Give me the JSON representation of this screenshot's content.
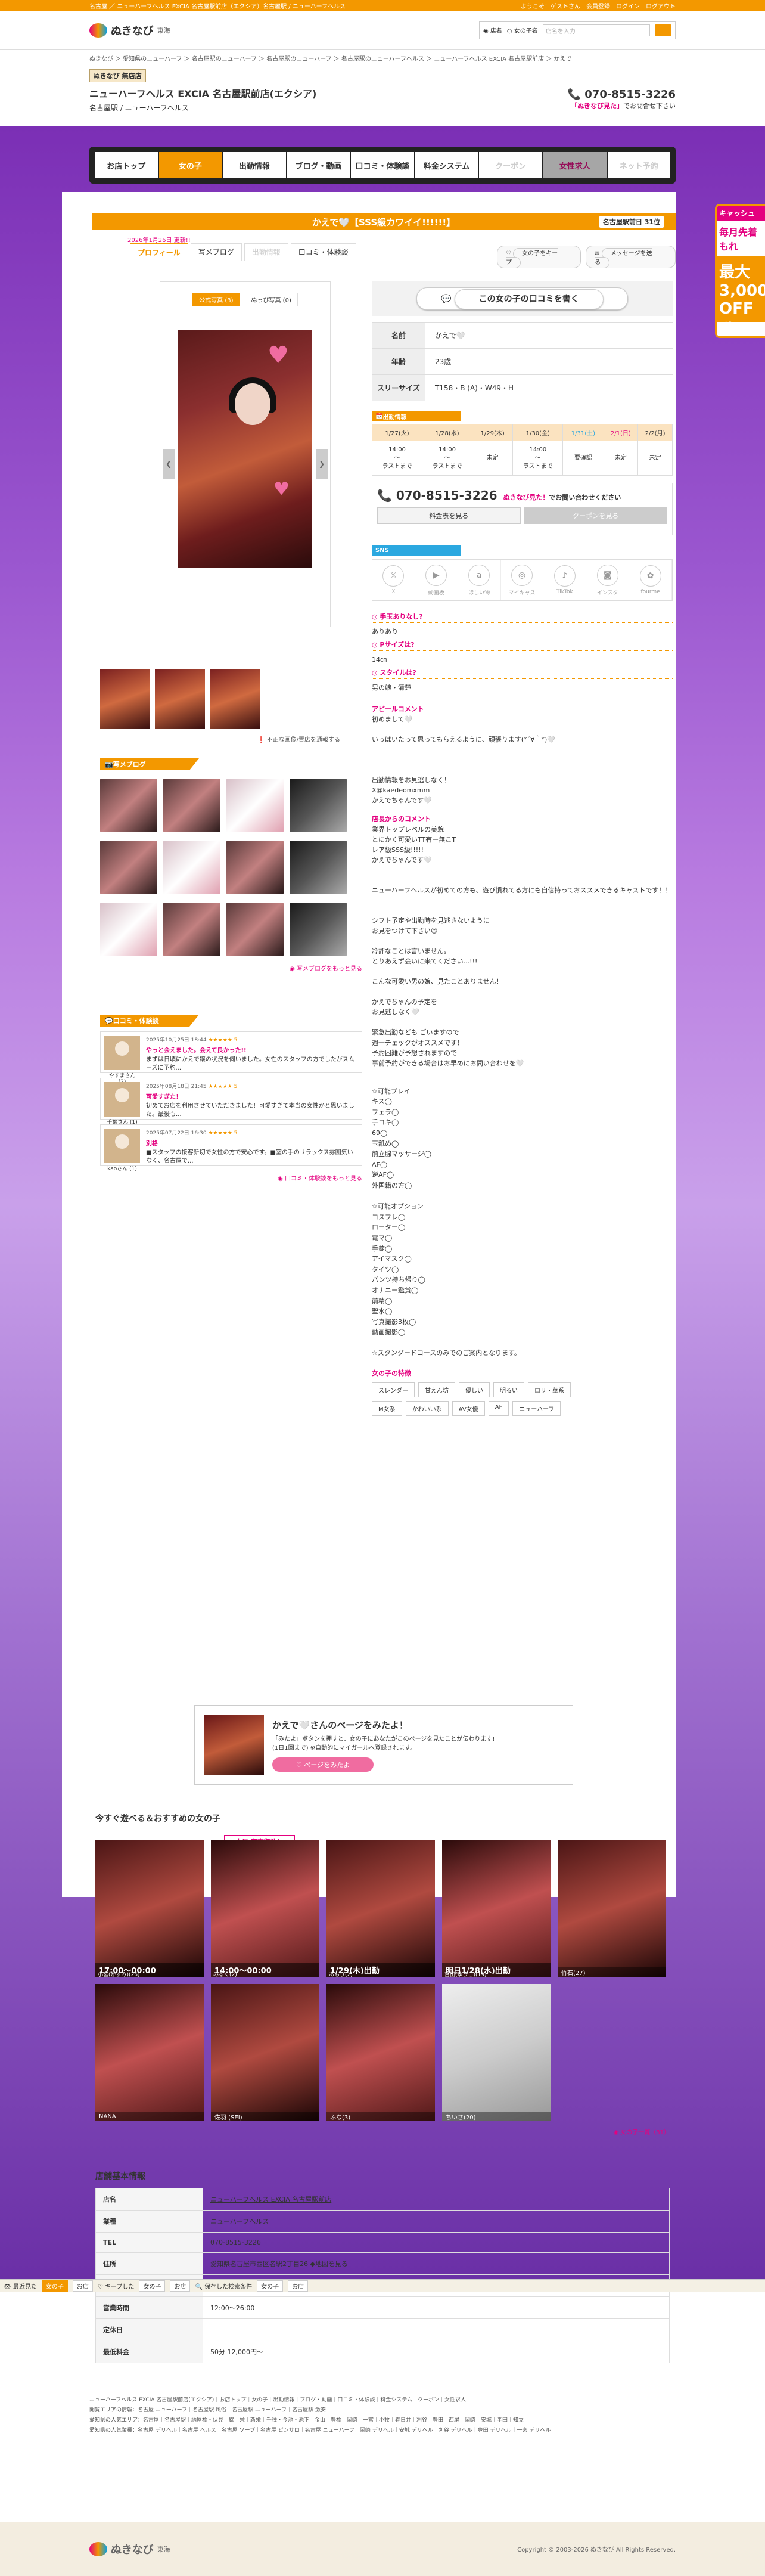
{
  "topbar": {
    "left": "名古屋 ／ ニューハーフヘルス EXCIA 名古屋駅前店（エクシア）名古屋駅 / ニューハーフヘルス",
    "welcome": "ようこそ！ゲストさん",
    "links": [
      "会員登録",
      "ログイン",
      "ログアウト"
    ]
  },
  "header": {
    "logo": "ぬきなび",
    "region": "東海",
    "search_opt1": "店名",
    "search_opt2": "女の子名",
    "search_placeholder": "店名を入力"
  },
  "breadcrumb": "ぬきなび ＞ 愛知県のニューハーフ ＞ 名古屋駅のニューハーフ ＞ 名古屋駅のニューハーフ ＞ 名古屋駅のニューハーフヘルス ＞ ニューハーフヘルス EXCIA 名古屋駅前店 ＞ かえで",
  "shop": {
    "tag": "ぬきなび 無店店",
    "name": "ニューハーフヘルス EXCIA 名古屋駅前店(エクシア)",
    "area": "名古屋駅 / ニューハーフヘルス",
    "phone": "070-8515-3226",
    "phone_note_b": "「ぬきなび見た」",
    "phone_note": "でお問合せ下さい"
  },
  "nav": [
    "お店トップ",
    "女の子",
    "出勤情報",
    "ブログ・動画",
    "口コミ・体験談",
    "料金システム",
    "クーポン",
    "女性求人",
    "ネット予約"
  ],
  "sidebanner": {
    "t1": "キャッシュ",
    "t2": "毎月先着 もれ",
    "t3": "最大3,000 OFF 遊べ"
  },
  "girl": {
    "title": "かえで🤍【SSS級カワイイ!!!!!!】",
    "rank": "名古屋駅前日 31位",
    "date": "2026年1月26日 更新!!",
    "tabs": [
      "プロフィール",
      "写メブログ",
      "出勤情報",
      "口コミ・体験談"
    ],
    "fav": "女の子をキープ",
    "msg": "メッセージを送る",
    "phototabs": [
      "公式写真 (3)",
      "ぬっぴ写真 (0)"
    ],
    "photonote": "不正な画像/置店を通報する"
  },
  "blog": {
    "title": "写メブログ",
    "more": "写メブログをもっと見る"
  },
  "reviews_title": "口コミ・体験談",
  "reviews": [
    {
      "date": "2025年10月25日 18:44",
      "stars": "★★★★★ 5",
      "title": "やっと会えました。会えて良かった!!",
      "text": "まずは日頃にかえで嬢の状況を伺いました。女性のスタッフの方でしたがスムーズに予約...",
      "name": "やすまさん (2)"
    },
    {
      "date": "2025年08月18日 21:45",
      "stars": "★★★★★ 5",
      "title": "可愛すぎた！",
      "text": "初めてお店を利用させていただきました！可愛すぎて本当の女性かと思いました。最後も...",
      "name": "千葉さん (1)"
    },
    {
      "date": "2025年07月22日 16:30",
      "stars": "★★★★★ 5",
      "title": "別格",
      "text": "■スタッフの接客新切で女性の方で安心です。■室の手のリラックス雰囲気いなく、名古屋で...",
      "name": "kaoさん (1)"
    }
  ],
  "reviews_more": "口コミ・体験談をもっと見る",
  "profile": {
    "cta": "この女の子の口コミを書く",
    "rows": [
      {
        "k": "名前",
        "v": "かえで🤍"
      },
      {
        "k": "年齢",
        "v": "23歳"
      },
      {
        "k": "スリーサイズ",
        "v": "T158・B (A)・W49・H"
      }
    ]
  },
  "schedule": {
    "title": "出勤情報",
    "days": [
      "1/27(火)",
      "1/28(水)",
      "1/29(木)",
      "1/30(金)",
      "1/31(土)",
      "2/1(日)",
      "2/2(月)"
    ],
    "times": [
      "14:00\n〜\nラストまで",
      "14:00\n〜\nラストまで",
      "未定",
      "14:00\n〜\nラストまで",
      "要確認",
      "未定",
      "未定"
    ]
  },
  "tel": {
    "num": "070-8515-3226",
    "note_b": "ぬきなび見た！",
    "note": "でお問い合わせください",
    "btn1": "料金表を見る",
    "btn2": "クーポンを見る"
  },
  "sns": {
    "title": "SNS",
    "items": [
      "X",
      "動画板",
      "ほしい物",
      "マイキャス",
      "TikTok",
      "インスタ",
      "fourme"
    ]
  },
  "qa": [
    {
      "q": "◎ 手玉ありなし?",
      "a": "ありあり"
    },
    {
      "q": "◎ Pサイズは?",
      "a": "14㎝"
    },
    {
      "q": "◎ スタイルは?",
      "a": "男の娘・清楚"
    }
  ],
  "appeal": {
    "h": "アピールコメント",
    "text": "初めまして🤍\n\nいっぱいたって思ってもらえるように、頑張ります(*´∀｀*)🤍\n\n\n\n出勤情報をお見逃しなく！\nX@kaedeomxmm\nかえでちゃんです🤍"
  },
  "shopcomment": {
    "h": "店長からのコメント",
    "text": "業界トップレベルの美貌\nとにかく可愛いTT有ー無こT\nレア級SSS級!!!!!\nかえでちゃんです🤍\n\n\nニューハーフヘルスが初めての方も、遊び慣れてる方にも自信持っておススメできるキャストです！！\n\n\nシフト予定や出勤時を見逃さないように\nお見をつけて下さい😄\n\n冷評なことは言いません。\nとりあえず会いに来てください...!!!\n\nこんな可愛い男の娘、見たことありません！\n\nかえでちゃんの予定を\nお見逃しなく🤍\n\n緊急出勤なども ごいますので\n週一チェックがオススメです！\n予約困難が予想されますので\n事前予約ができる場合はお早めにお問い合わせを🤍"
  },
  "options": "☆可能プレイ\nキス◯\nフェラ◯\n手コキ◯\n69◯\n玉舐め◯\n前立腺マッサージ◯\nAF◯\n逆AF◯\n外国籍の方◯\n\n☆可能オプション\nコスプレ◯\nローター◯\n電マ◯\n手錠◯\nアイマスク◯\nタイツ◯\nパンツ持ち帰り◯\nオナニー鑑賞◯\n前精◯\n聖水◯\n写真撮影3枚◯\n動画撮影◯\n\n☆スタンダードコースのみでのご案内となります。",
  "features": {
    "h": "女の子の特徴",
    "chips": [
      "スレンダー",
      "甘えん坊",
      "優しい",
      "明るい",
      "ロリ・華系",
      "M女系",
      "かわいい系",
      "AV女優",
      "AF",
      "ニューハーフ"
    ]
  },
  "promo": {
    "t": "かえで🤍さんのページをみたよ！",
    "d": "「みたよ」ボタンを押すと、女の子にあなたがこのページを見たことが伝わります!\n(1日1回まで) ※自動的にマイガールへ登録されます。",
    "b": "ページをみたよ"
  },
  "recommend": {
    "title": "今すぐ遊べる＆おすすめの女の子",
    "badge": "本日 完売御礼！",
    "cells": [
      {
        "cap": "17:00〜00:00",
        "sub": "小宮(かすみ)(26)"
      },
      {
        "cap": "14:00〜00:00",
        "sub": "みるく(2)"
      },
      {
        "cap": "1/29(木)出勤",
        "sub": "あもり(2)"
      },
      {
        "cap": "明日1/28(水)出勤",
        "sub": "吉田(ゆうこ)(19)"
      },
      {
        "cap": "",
        "sub": "竹石(27)"
      },
      {
        "cap": "",
        "sub": "NANA"
      },
      {
        "cap": "",
        "sub": "佐羽 (SEI)"
      },
      {
        "cap": "",
        "sub": "ふな(3)"
      },
      {
        "cap": "",
        "sub": "ちいさ(20)"
      }
    ],
    "more": "女の子一覧（31）"
  },
  "shopinfo": {
    "title": "店舗基本情報",
    "rows": [
      {
        "k": "店名",
        "v": "ニューハーフヘルス EXCIA 名古屋駅前店"
      },
      {
        "k": "業種",
        "v": "ニューハーフヘルス"
      },
      {
        "k": "TEL",
        "v": "070-8515-3226"
      },
      {
        "k": "住所",
        "v": "愛知県名古屋市西区名駅2丁目26 ◆地図を見る"
      },
      {
        "k": "",
        "v": "店舗付近に駐車場等多数あるのでお車でもアクセスしやすいです♪電話でご確認ください"
      },
      {
        "k": "営業時間",
        "v": "12:00〜26:00"
      },
      {
        "k": "定休日",
        "v": ""
      },
      {
        "k": "最低料金",
        "v": "50分 12,000円〜"
      }
    ]
  },
  "fixbar": {
    "l1": "最近見た",
    "c1": "女の子",
    "c2": "お店",
    "l2": "キープした",
    "c3": "女の子",
    "c4": "お店",
    "l3": "保存した検索条件",
    "c5": "女の子",
    "c6": "お店"
  },
  "footlinks": {
    "line1": "ニューハーフヘルス EXCIA 名古屋駅前店(エクシア)｜お店トップ｜女の子｜出勤情報｜ブログ・動画｜口コミ・体験談｜料金システム｜クーポン｜女性求人",
    "line2": "閲覧エリアの情報：名古屋 ニューハーフ｜名古屋駅 風俗｜名古屋駅 ニューハーフ｜名古屋駅 激安",
    "line3": "愛知県の人気エリア：名古屋｜名古屋駅｜納屋橋・伏見｜錦｜栄｜新栄｜千種・今池・池下｜金山｜豊橋｜岡崎｜一宮｜小牧｜春日井｜刈谷｜豊田｜西尾｜岡崎｜安城｜半田｜知立",
    "line4": "愛知県の人気業種：名古屋 デリヘル｜名古屋 ヘルス｜名古屋 ソープ｜名古屋 ピンサロ｜名古屋 ニューハーフ｜岡崎 デリヘル｜安城 デリヘル｜刈谷 デリヘル｜豊田 デリヘル｜一宮 デリヘル"
  },
  "footer": {
    "logo": "ぬきなび",
    "region": "東海",
    "copy": "Copyright © 2003-2026 ぬきなび All Rights Reserved."
  }
}
